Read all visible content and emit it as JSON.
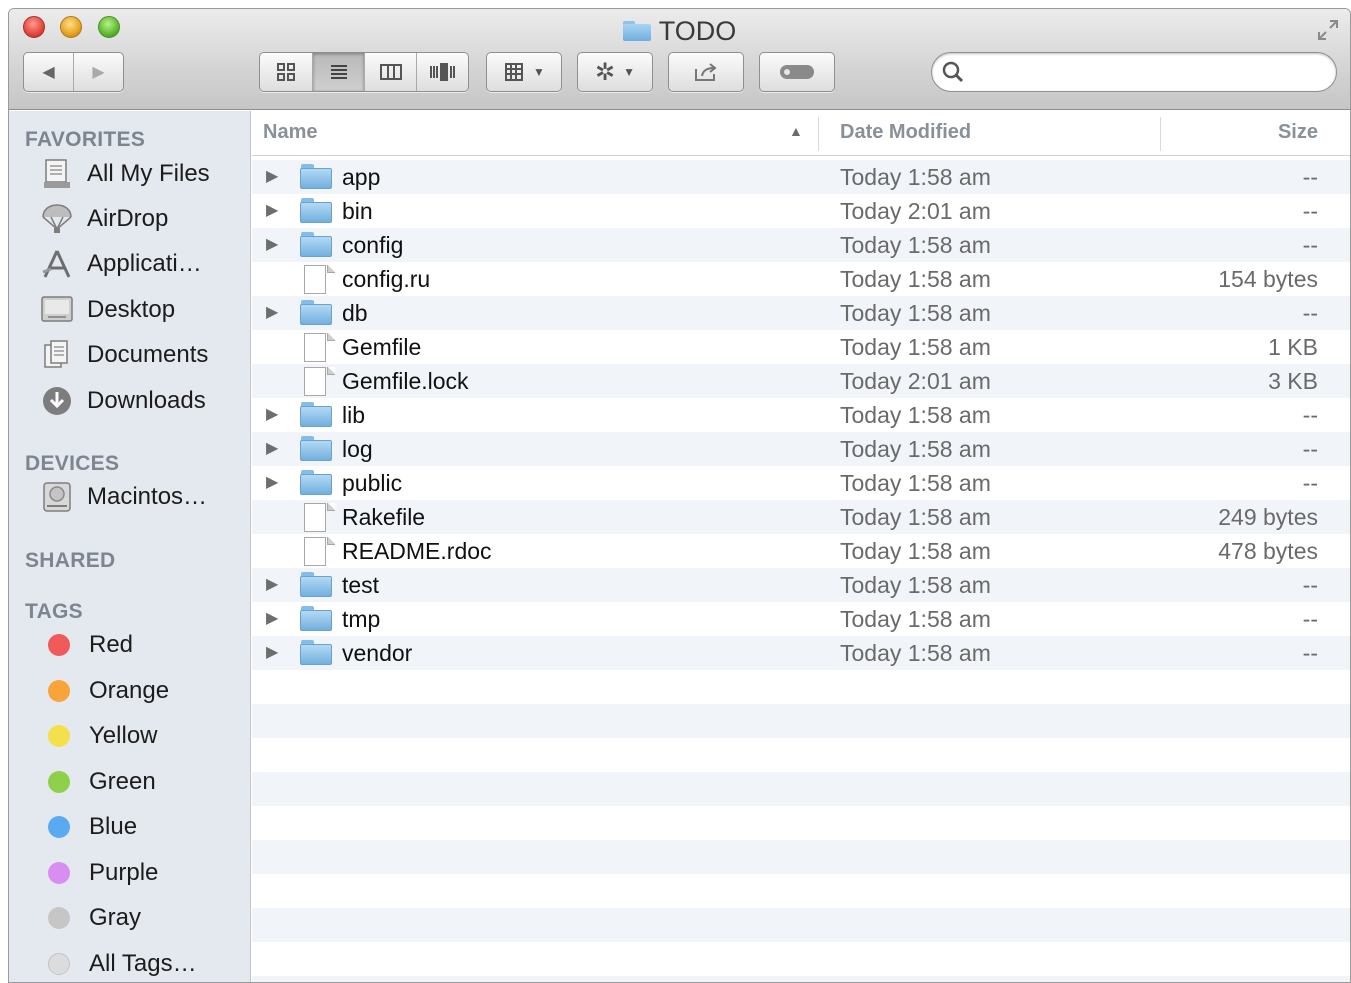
{
  "window": {
    "title": "TODO"
  },
  "toolbar": {
    "back": "◀",
    "forward": "▶",
    "views": [
      "icon-view",
      "list-view",
      "column-view",
      "coverflow-view"
    ],
    "search_placeholder": ""
  },
  "sidebar": {
    "favorites_heading": "FAVORITES",
    "favorites": [
      {
        "label": "All My Files",
        "icon": "all-my-files-icon"
      },
      {
        "label": "AirDrop",
        "icon": "airdrop-icon"
      },
      {
        "label": "Applicati…",
        "icon": "applications-icon"
      },
      {
        "label": "Desktop",
        "icon": "desktop-icon"
      },
      {
        "label": "Documents",
        "icon": "documents-icon"
      },
      {
        "label": "Downloads",
        "icon": "downloads-icon"
      }
    ],
    "devices_heading": "DEVICES",
    "devices": [
      {
        "label": "Macintos…",
        "icon": "hard-drive-icon"
      }
    ],
    "shared_heading": "SHARED",
    "tags_heading": "TAGS",
    "tags": [
      {
        "label": "Red",
        "color": "#f05a5a"
      },
      {
        "label": "Orange",
        "color": "#f8a43a"
      },
      {
        "label": "Yellow",
        "color": "#f4e04a"
      },
      {
        "label": "Green",
        "color": "#8ed04a"
      },
      {
        "label": "Blue",
        "color": "#5aaaf2"
      },
      {
        "label": "Purple",
        "color": "#d88ef0"
      },
      {
        "label": "Gray",
        "color": "#c6c6c6"
      },
      {
        "label": "All Tags…",
        "color": "#dcdcdc"
      }
    ]
  },
  "list": {
    "columns": {
      "name": "Name",
      "date": "Date Modified",
      "size": "Size"
    },
    "files": [
      {
        "name": "app",
        "type": "folder",
        "date": "Today 1:58 am",
        "size": "--"
      },
      {
        "name": "bin",
        "type": "folder",
        "date": "Today 2:01 am",
        "size": "--"
      },
      {
        "name": "config",
        "type": "folder",
        "date": "Today 1:58 am",
        "size": "--"
      },
      {
        "name": "config.ru",
        "type": "file",
        "date": "Today 1:58 am",
        "size": "154 bytes"
      },
      {
        "name": "db",
        "type": "folder",
        "date": "Today 1:58 am",
        "size": "--"
      },
      {
        "name": "Gemfile",
        "type": "file",
        "date": "Today 1:58 am",
        "size": "1 KB"
      },
      {
        "name": "Gemfile.lock",
        "type": "file",
        "date": "Today 2:01 am",
        "size": "3 KB"
      },
      {
        "name": "lib",
        "type": "folder",
        "date": "Today 1:58 am",
        "size": "--"
      },
      {
        "name": "log",
        "type": "folder",
        "date": "Today 1:58 am",
        "size": "--"
      },
      {
        "name": "public",
        "type": "folder",
        "date": "Today 1:58 am",
        "size": "--"
      },
      {
        "name": "Rakefile",
        "type": "file",
        "date": "Today 1:58 am",
        "size": "249 bytes"
      },
      {
        "name": "README.rdoc",
        "type": "file",
        "date": "Today 1:58 am",
        "size": "478 bytes"
      },
      {
        "name": "test",
        "type": "folder",
        "date": "Today 1:58 am",
        "size": "--"
      },
      {
        "name": "tmp",
        "type": "folder",
        "date": "Today 1:58 am",
        "size": "--"
      },
      {
        "name": "vendor",
        "type": "folder",
        "date": "Today 1:58 am",
        "size": "--"
      }
    ]
  }
}
